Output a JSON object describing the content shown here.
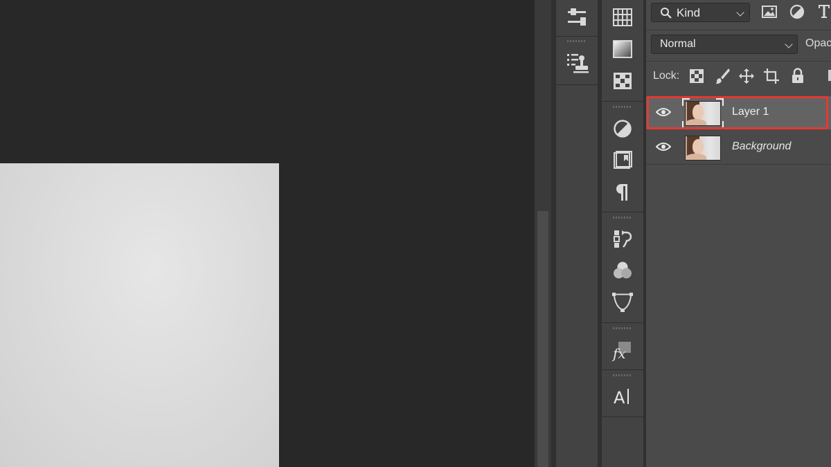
{
  "app": "Adobe Photoshop",
  "filter": {
    "kind_label": "Kind"
  },
  "blend": {
    "mode": "Normal",
    "opacity_label": "Opac"
  },
  "lock": {
    "label": "Lock:"
  },
  "layers": [
    {
      "name": "Layer 1",
      "selected": true,
      "visible": true,
      "italic": false
    },
    {
      "name": "Background",
      "selected": false,
      "visible": true,
      "italic": true
    }
  ],
  "dock_a_icons": [
    "properties-sliders-icon",
    "clone-source-icon"
  ],
  "dock_b_icons": [
    "swatches-icon",
    "gradient-icon",
    "patterns-icon",
    "adjustments-icon",
    "libraries-icon",
    "paragraph-icon",
    "history-icon",
    "channels-icon",
    "paths-icon",
    "styles-fx-icon",
    "character-icon"
  ],
  "colors": {
    "highlight": "#e53935",
    "panel": "#4a4a4a",
    "canvas": "#282828",
    "selected_row": "#636363"
  }
}
